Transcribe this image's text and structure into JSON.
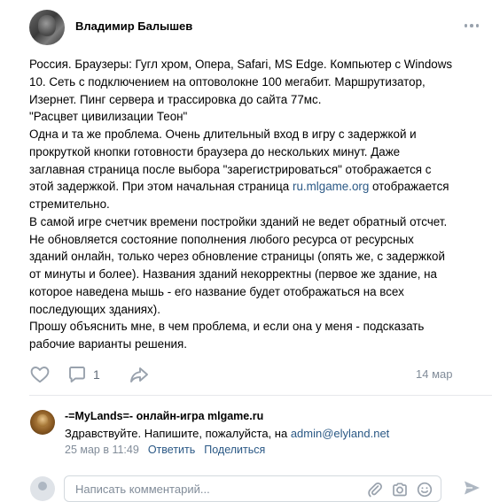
{
  "post": {
    "author": "Владимир Балышев",
    "lines": [
      "Россия. Браузеры: Гугл хром, Опера, Safari, MS Edge. Компьютер с Windows",
      "10. Сеть с подключением на оптоволокне 100 мегабит. Маршрутизатор,",
      "Изернет. Пинг сервера и трассировка до сайта 77мс.",
      "\"Расцвет цивилизации Теон\"",
      "Одна и та же проблема. Очень длительный вход в игру с задержкой и",
      "прокруткой кнопки готовности браузера до нескольких минут. Даже",
      "заглавная страница после выбора \"зарегистрироваться\" отображается с"
    ],
    "line8_before": "этой задержкой. При этом начальная страница ",
    "line8_link": "ru.mlgame.org",
    "line8_after": " отображается",
    "lines_rest": [
      "стремительно.",
      "В самой игре счетчик времени постройки зданий не ведет обратный отсчет.",
      "Не обновляется состояние пополнения любого ресурса от ресурсных",
      "зданий онлайн, только через обновление страницы (опять же, с задержкой",
      "от минуты и более). Названия зданий некорректны (первое же здание, на",
      "которое наведена мышь - его название будет отображаться на всех",
      "последующих зданиях).",
      "Прошу объяснить мне, в чем проблема, и если она у меня - подсказать",
      "рабочие варианты решения."
    ],
    "comment_count": "1",
    "date": "14 мар"
  },
  "reply": {
    "author": "-=MyLands=- онлайн-игра mlgame.ru",
    "text_before": "Здравствуйте. Напишите, пожалуйста, на ",
    "email": "admin@elyland.net",
    "timestamp": "25 мар в 11:49",
    "reply_label": "Ответить",
    "share_label": "Поделиться"
  },
  "composer": {
    "placeholder": "Написать комментарий..."
  },
  "colors": {
    "link": "#2a5885",
    "icon": "#99a2ad",
    "muted": "#818c99",
    "divider": "#e7e8ec"
  },
  "icons": [
    "more-icon",
    "heart-icon",
    "comment-icon",
    "share-icon",
    "attachment-icon",
    "camera-icon",
    "emoji-icon",
    "send-icon"
  ]
}
